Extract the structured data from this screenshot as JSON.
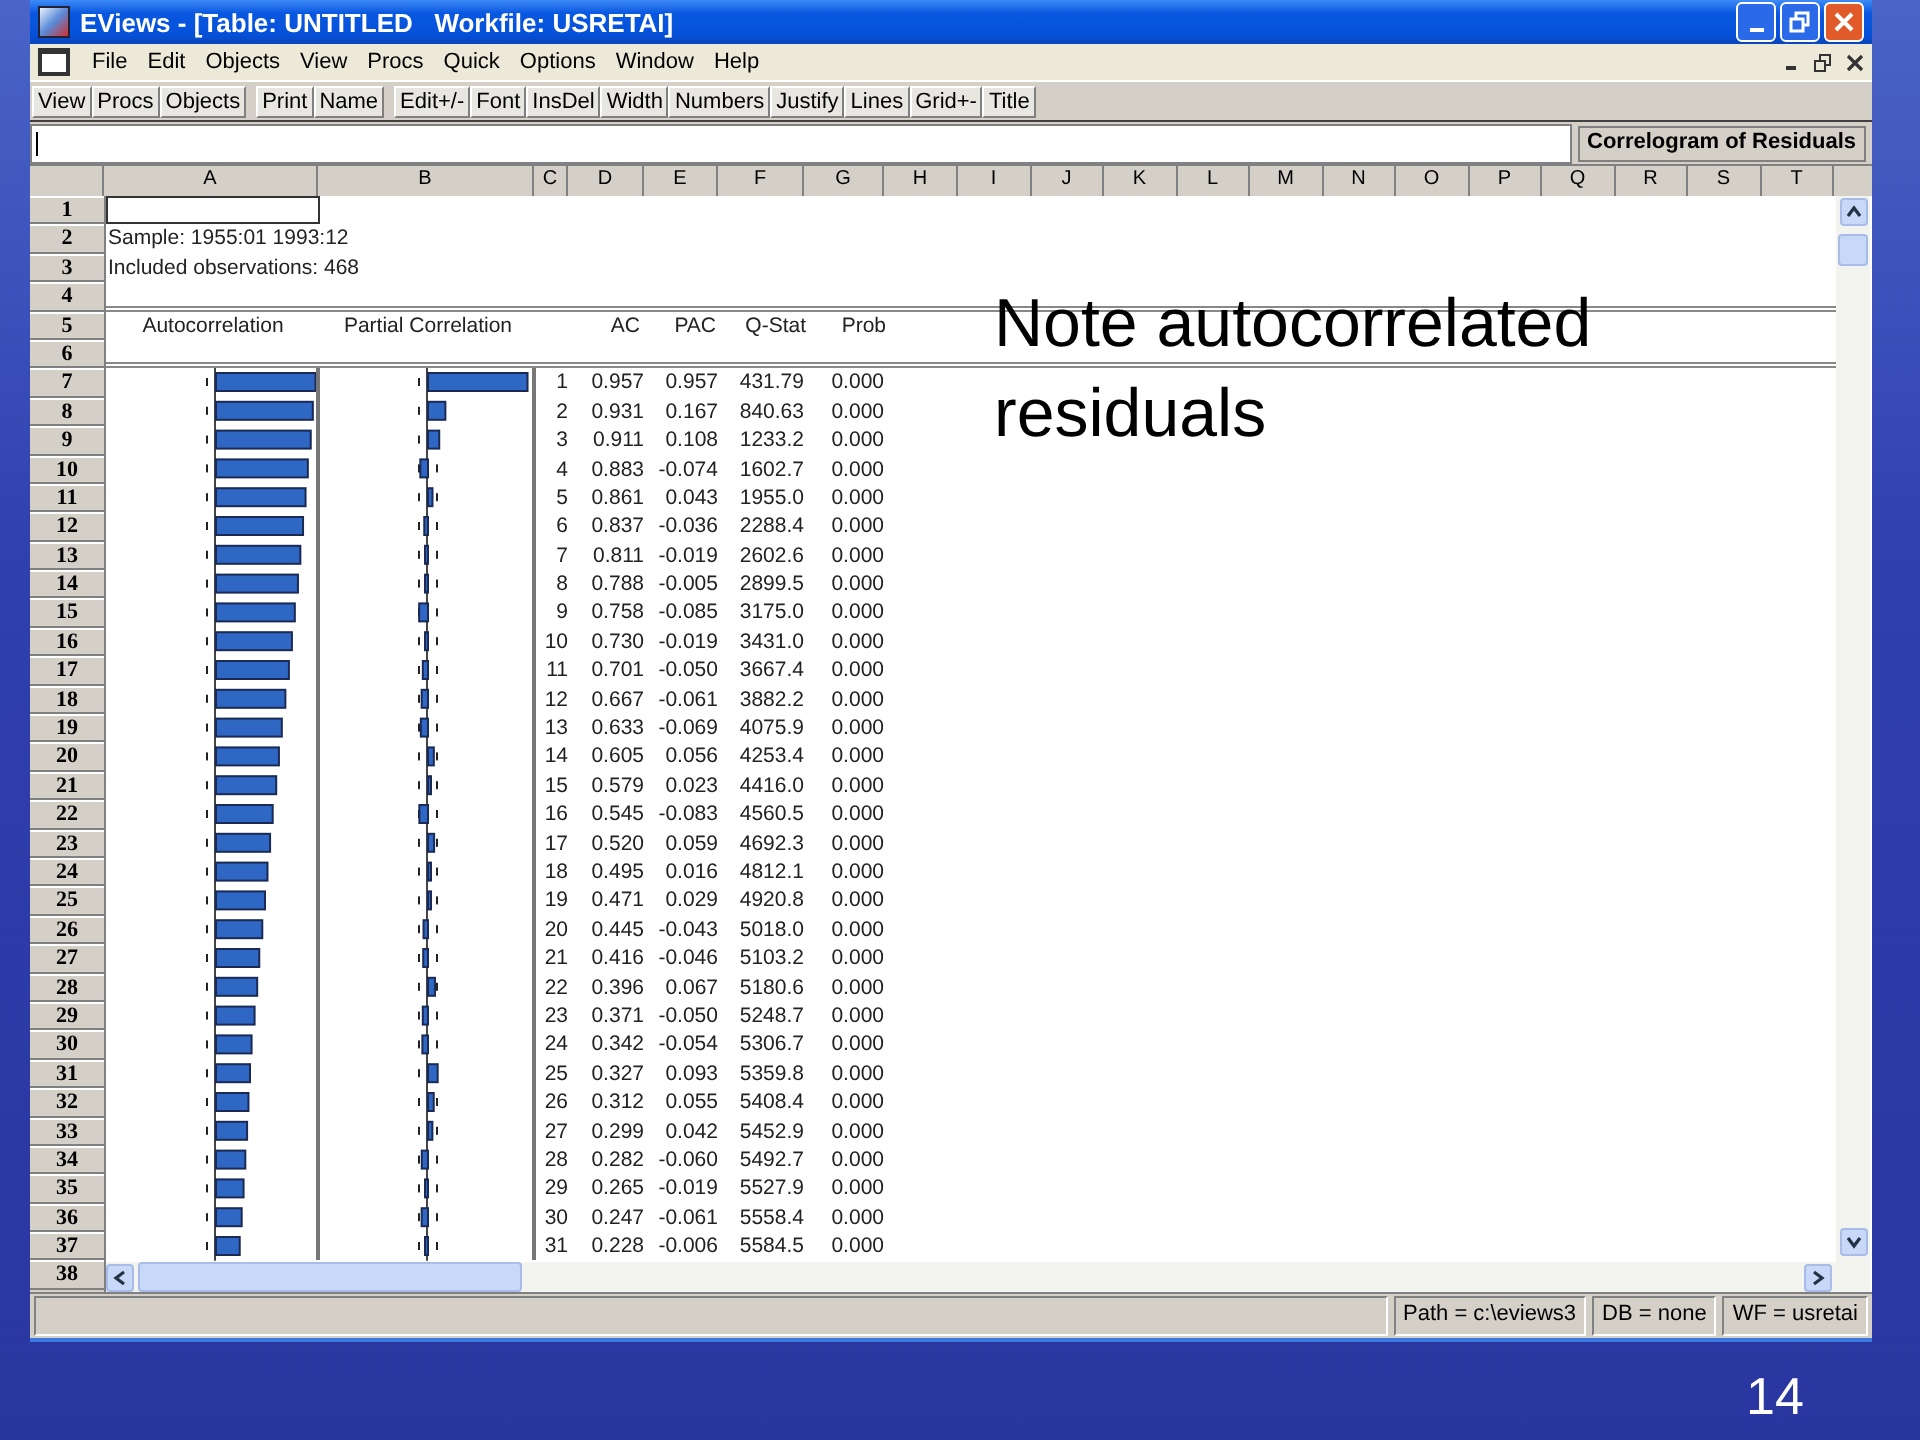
{
  "window": {
    "title": "EViews - [Table: UNTITLED   Workfile: USRETAI]"
  },
  "menu_bar": [
    "File",
    "Edit",
    "Objects",
    "View",
    "Procs",
    "Quick",
    "Options",
    "Window",
    "Help"
  ],
  "toolbar_groups": [
    [
      "View",
      "Procs",
      "Objects"
    ],
    [
      "Print",
      "Name"
    ],
    [
      "Edit+/-",
      "Font",
      "InsDel",
      "Width",
      "Numbers",
      "Justify",
      "Lines",
      "Grid+-",
      "Title"
    ]
  ],
  "table_title": "Correlogram of Residuals",
  "sheet": {
    "columns": [
      "A",
      "B",
      "C",
      "D",
      "E",
      "F",
      "G",
      "H",
      "I",
      "J",
      "K",
      "L",
      "M",
      "N",
      "O",
      "P",
      "Q",
      "R",
      "S",
      "T"
    ],
    "rows": [
      "1",
      "2",
      "3",
      "4",
      "5",
      "6",
      "7",
      "8",
      "9",
      "10",
      "11",
      "12",
      "13",
      "14",
      "15",
      "16",
      "17",
      "18",
      "19",
      "20",
      "21",
      "22",
      "23",
      "24",
      "25",
      "26",
      "27",
      "28",
      "29",
      "30",
      "31",
      "32",
      "33",
      "34",
      "35",
      "36",
      "37",
      "38"
    ]
  },
  "sample": "Sample: 1955:01 1993:12",
  "observations": "Included observations: 468",
  "correlogram": {
    "headers": [
      "Autocorrelation",
      "Partial Correlation",
      "AC",
      "PAC",
      "Q-Stat",
      "Prob"
    ],
    "rows": [
      {
        "lag": "1",
        "ac": "0.957",
        "pac": "0.957",
        "q_stat": "431.79",
        "prob": "0.000"
      },
      {
        "lag": "2",
        "ac": "0.931",
        "pac": "0.167",
        "q_stat": "840.63",
        "prob": "0.000"
      },
      {
        "lag": "3",
        "ac": "0.911",
        "pac": "0.108",
        "q_stat": "1233.2",
        "prob": "0.000"
      },
      {
        "lag": "4",
        "ac": "0.883",
        "pac": "-0.074",
        "q_stat": "1602.7",
        "prob": "0.000"
      },
      {
        "lag": "5",
        "ac": "0.861",
        "pac": "0.043",
        "q_stat": "1955.0",
        "prob": "0.000"
      },
      {
        "lag": "6",
        "ac": "0.837",
        "pac": "-0.036",
        "q_stat": "2288.4",
        "prob": "0.000"
      },
      {
        "lag": "7",
        "ac": "0.811",
        "pac": "-0.019",
        "q_stat": "2602.6",
        "prob": "0.000"
      },
      {
        "lag": "8",
        "ac": "0.788",
        "pac": "-0.005",
        "q_stat": "2899.5",
        "prob": "0.000"
      },
      {
        "lag": "9",
        "ac": "0.758",
        "pac": "-0.085",
        "q_stat": "3175.0",
        "prob": "0.000"
      },
      {
        "lag": "10",
        "ac": "0.730",
        "pac": "-0.019",
        "q_stat": "3431.0",
        "prob": "0.000"
      },
      {
        "lag": "11",
        "ac": "0.701",
        "pac": "-0.050",
        "q_stat": "3667.4",
        "prob": "0.000"
      },
      {
        "lag": "12",
        "ac": "0.667",
        "pac": "-0.061",
        "q_stat": "3882.2",
        "prob": "0.000"
      },
      {
        "lag": "13",
        "ac": "0.633",
        "pac": "-0.069",
        "q_stat": "4075.9",
        "prob": "0.000"
      },
      {
        "lag": "14",
        "ac": "0.605",
        "pac": "0.056",
        "q_stat": "4253.4",
        "prob": "0.000"
      },
      {
        "lag": "15",
        "ac": "0.579",
        "pac": "0.023",
        "q_stat": "4416.0",
        "prob": "0.000"
      },
      {
        "lag": "16",
        "ac": "0.545",
        "pac": "-0.083",
        "q_stat": "4560.5",
        "prob": "0.000"
      },
      {
        "lag": "17",
        "ac": "0.520",
        "pac": "0.059",
        "q_stat": "4692.3",
        "prob": "0.000"
      },
      {
        "lag": "18",
        "ac": "0.495",
        "pac": "0.016",
        "q_stat": "4812.1",
        "prob": "0.000"
      },
      {
        "lag": "19",
        "ac": "0.471",
        "pac": "0.029",
        "q_stat": "4920.8",
        "prob": "0.000"
      },
      {
        "lag": "20",
        "ac": "0.445",
        "pac": "-0.043",
        "q_stat": "5018.0",
        "prob": "0.000"
      },
      {
        "lag": "21",
        "ac": "0.416",
        "pac": "-0.046",
        "q_stat": "5103.2",
        "prob": "0.000"
      },
      {
        "lag": "22",
        "ac": "0.396",
        "pac": "0.067",
        "q_stat": "5180.6",
        "prob": "0.000"
      },
      {
        "lag": "23",
        "ac": "0.371",
        "pac": "-0.050",
        "q_stat": "5248.7",
        "prob": "0.000"
      },
      {
        "lag": "24",
        "ac": "0.342",
        "pac": "-0.054",
        "q_stat": "5306.7",
        "prob": "0.000"
      },
      {
        "lag": "25",
        "ac": "0.327",
        "pac": "0.093",
        "q_stat": "5359.8",
        "prob": "0.000"
      },
      {
        "lag": "26",
        "ac": "0.312",
        "pac": "0.055",
        "q_stat": "5408.4",
        "prob": "0.000"
      },
      {
        "lag": "27",
        "ac": "0.299",
        "pac": "0.042",
        "q_stat": "5452.9",
        "prob": "0.000"
      },
      {
        "lag": "28",
        "ac": "0.282",
        "pac": "-0.060",
        "q_stat": "5492.7",
        "prob": "0.000"
      },
      {
        "lag": "29",
        "ac": "0.265",
        "pac": "-0.019",
        "q_stat": "5527.9",
        "prob": "0.000"
      },
      {
        "lag": "30",
        "ac": "0.247",
        "pac": "-0.061",
        "q_stat": "5558.4",
        "prob": "0.000"
      },
      {
        "lag": "31",
        "ac": "0.228",
        "pac": "-0.006",
        "q_stat": "5584.5",
        "prob": "0.000"
      }
    ]
  },
  "status_bar": [
    "Path = c:\\eviews3",
    "DB = none",
    "WF = usretai"
  ],
  "note": "Note autocorrelated residuals",
  "slide_number": "14"
}
